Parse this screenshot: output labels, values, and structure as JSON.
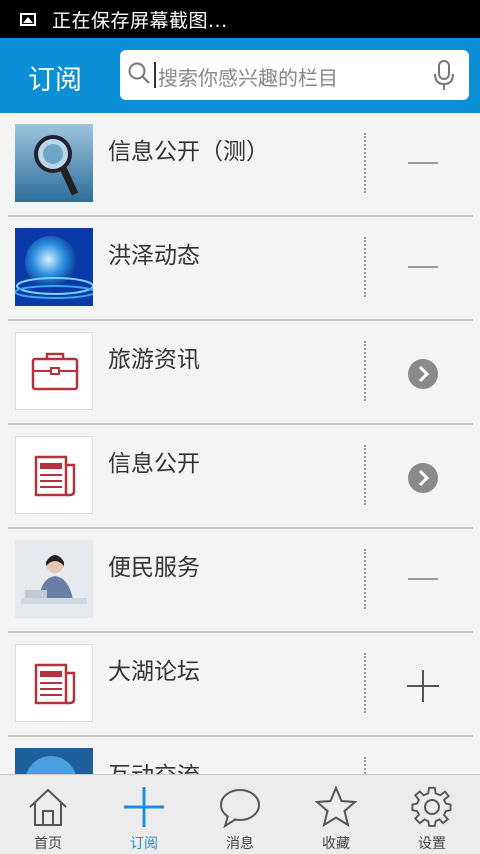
{
  "status_bar": {
    "text": "正在保存屏幕截图..."
  },
  "header": {
    "title": "订阅",
    "search_placeholder": "搜索你感兴趣的栏目"
  },
  "list": [
    {
      "name": "信息公开（测）",
      "thumb": "magnifier-globe-photo",
      "action": "minus"
    },
    {
      "name": "洪泽动态",
      "thumb": "blue-globe-photo",
      "action": "minus"
    },
    {
      "name": "旅游资讯",
      "thumb": "briefcase-icon",
      "action": "arrow"
    },
    {
      "name": "信息公开",
      "thumb": "newspaper-icon",
      "action": "arrow"
    },
    {
      "name": "便民服务",
      "thumb": "service-agent-photo",
      "action": "minus"
    },
    {
      "name": "大湖论坛",
      "thumb": "newspaper-icon",
      "action": "plus"
    },
    {
      "name": "互动交流",
      "thumb": "blue-globe-photo",
      "action": "none"
    }
  ],
  "bottom_nav": [
    {
      "label": "首页",
      "icon": "home-icon"
    },
    {
      "label": "订阅",
      "icon": "plus-icon",
      "active": true
    },
    {
      "label": "消息",
      "icon": "chat-bubble-icon"
    },
    {
      "label": "收藏",
      "icon": "star-icon"
    },
    {
      "label": "设置",
      "icon": "gear-icon"
    }
  ],
  "colors": {
    "header": "#0b8fd6",
    "active_tab": "#1a8fe0",
    "icon_red": "#b5323d"
  }
}
